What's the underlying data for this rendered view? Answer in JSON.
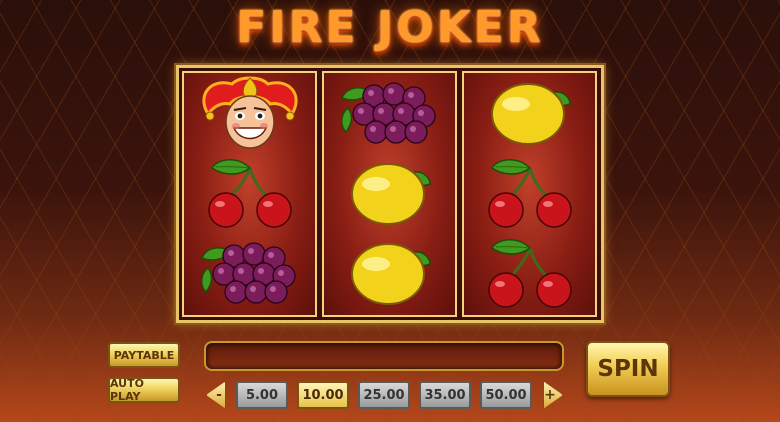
{
  "game": {
    "title": "FIRE JOKER"
  },
  "reels": [
    {
      "symbols": [
        "joker-icon",
        "cherry-icon",
        "grape-icon"
      ]
    },
    {
      "symbols": [
        "grape-icon",
        "lemon-icon",
        "lemon-icon"
      ]
    },
    {
      "symbols": [
        "lemon-icon",
        "cherry-icon",
        "cherry-icon"
      ]
    }
  ],
  "controls": {
    "paytable_label": "PAYTABLE",
    "autoplay_label": "AUTO PLAY",
    "spin_label": "SPIN",
    "message": "",
    "bet_decrease_label": "-",
    "bet_increase_label": "+",
    "bets": [
      "5.00",
      "10.00",
      "25.00",
      "35.00",
      "50.00"
    ],
    "selected_bet": "10.00"
  },
  "colors": {
    "title": "#ff9a2a",
    "button_gold": "#f0d25c",
    "reel_red": "#8a1e14"
  }
}
